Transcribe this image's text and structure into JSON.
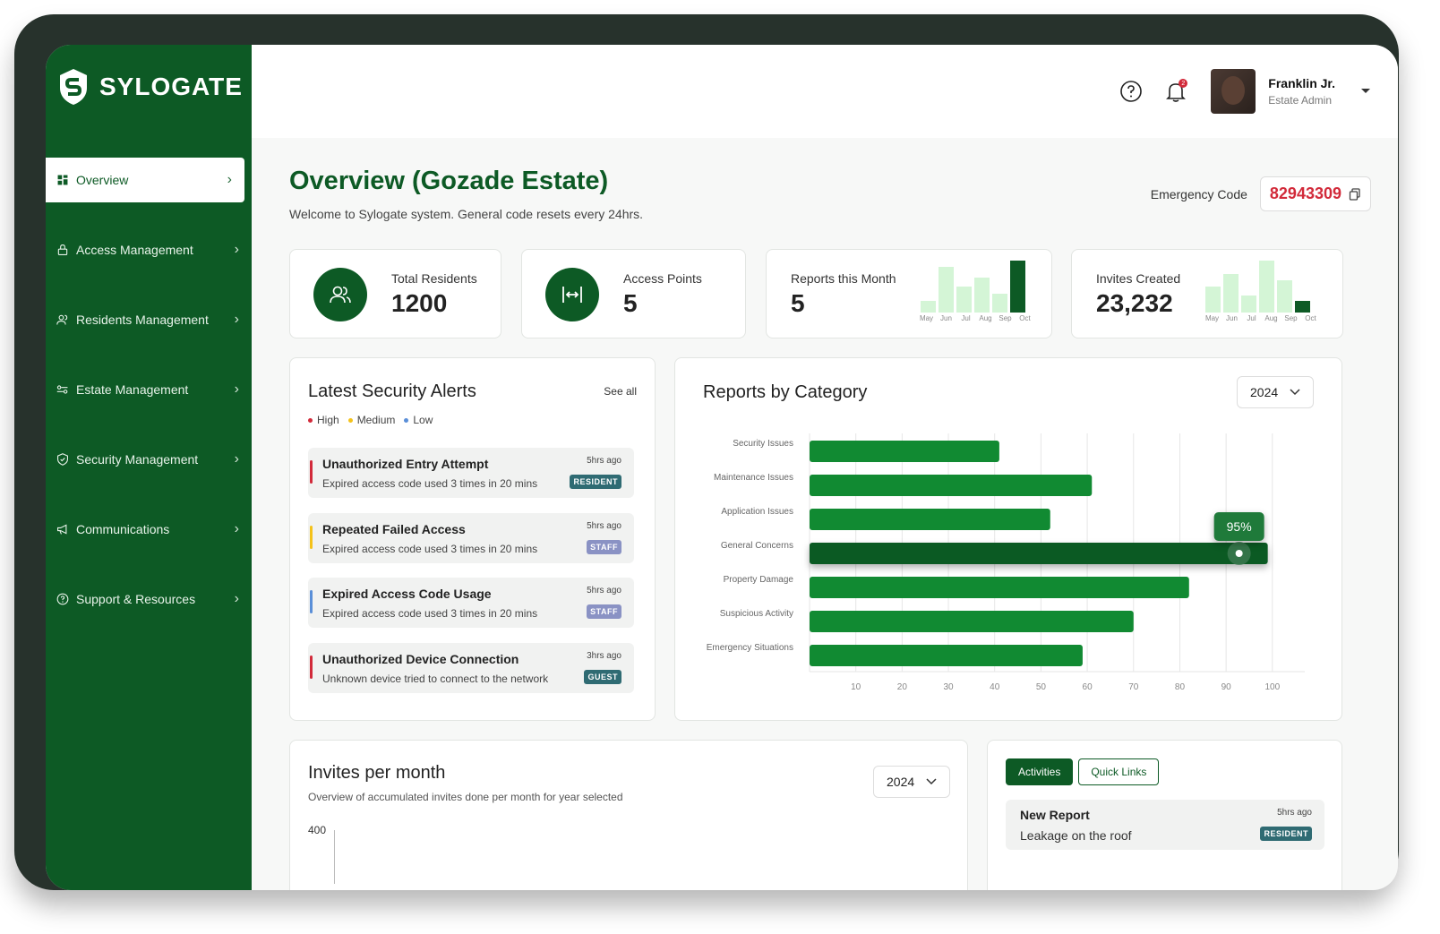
{
  "brand": {
    "name": "SYLOGATE"
  },
  "nav": [
    {
      "label": "Overview",
      "icon": "grid-icon",
      "active": true
    },
    {
      "label": "Access Management",
      "icon": "lock-icon"
    },
    {
      "label": "Residents Management",
      "icon": "users-icon"
    },
    {
      "label": "Estate Management",
      "icon": "estate-icon"
    },
    {
      "label": "Security Management",
      "icon": "shield-icon"
    },
    {
      "label": "Communications",
      "icon": "megaphone-icon"
    },
    {
      "label": "Support & Resources",
      "icon": "help-circle-icon"
    }
  ],
  "header": {
    "user_name": "Franklin Jr.",
    "user_role": "Estate Admin",
    "notification_count": "2"
  },
  "page": {
    "title": "Overview (Gozade Estate)",
    "subtitle": "Welcome to Sylogate system. General code resets every 24hrs.",
    "emergency_label": "Emergency Code",
    "emergency_code": "82943309"
  },
  "stats": {
    "residents": {
      "label": "Total Residents",
      "value": "1200"
    },
    "access": {
      "label": "Access Points",
      "value": "5"
    },
    "reports": {
      "label": "Reports this Month",
      "value": "5",
      "months": [
        "May",
        "Jun",
        "Jul",
        "Aug",
        "Sep",
        "Oct"
      ],
      "levels": [
        0.22,
        0.88,
        0.5,
        0.68,
        0.36,
        1.0
      ]
    },
    "invites": {
      "label": "Invites Created",
      "value": "23,232",
      "months": [
        "May",
        "Jun",
        "Jul",
        "Aug",
        "Sep",
        "Oct"
      ],
      "levels": [
        0.5,
        0.75,
        0.32,
        1.0,
        0.62,
        0.22
      ]
    }
  },
  "alerts": {
    "title": "Latest Security Alerts",
    "see_all": "See all",
    "legend": [
      {
        "label": "High",
        "color": "#d22a3a"
      },
      {
        "label": "Medium",
        "color": "#f4c21a"
      },
      {
        "label": "Low",
        "color": "#5a8fd8"
      }
    ],
    "items": [
      {
        "title": "Unauthorized Entry Attempt",
        "desc": "Expired access code used 3 times in 20 mins",
        "time": "5hrs ago",
        "badge": "RESIDENT",
        "badge_color": "#2f6b73",
        "severity_color": "#d22a3a"
      },
      {
        "title": "Repeated Failed Access",
        "desc": "Expired access code used 3 times in 20 mins",
        "time": "5hrs ago",
        "badge": "STAFF",
        "badge_color": "#8a92c4",
        "severity_color": "#f4c21a"
      },
      {
        "title": "Expired Access Code Usage",
        "desc": "Expired access code used 3 times in 20 mins",
        "time": "5hrs ago",
        "badge": "STAFF",
        "badge_color": "#8a92c4",
        "severity_color": "#5a8fd8"
      },
      {
        "title": "Unauthorized Device Connection",
        "desc": "Unknown device tried to connect to the network",
        "time": "3hrs ago",
        "badge": "GUEST",
        "badge_color": "#2f6b73",
        "severity_color": "#d22a3a"
      }
    ]
  },
  "reports_chart": {
    "title": "Reports by Category",
    "year": "2024",
    "tooltip": "95%"
  },
  "chart_data": {
    "type": "bar",
    "orientation": "horizontal",
    "categories": [
      "Security Issues",
      "Maintenance Issues",
      "Application Issues",
      "General Concerns",
      "Property Damage",
      "Suspicious Activity",
      "Emergency Situations"
    ],
    "values": [
      41,
      61,
      52,
      99,
      82,
      70,
      59
    ],
    "highlight_index": 3,
    "xlim": [
      0,
      107
    ],
    "xticks": [
      10,
      20,
      30,
      40,
      50,
      60,
      70,
      80,
      90,
      100
    ],
    "grid": true,
    "title": "Reports by Category",
    "xlabel": "",
    "ylabel": ""
  },
  "invites_chart": {
    "title": "Invites per month",
    "subtitle": "Overview of accumulated invites done per month for year selected",
    "year": "2024",
    "y_top_label": "400"
  },
  "activities": {
    "tabs": [
      "Activities",
      "Quick Links"
    ],
    "items": [
      {
        "title": "New Report",
        "desc": "Leakage on the roof",
        "time": "5hrs ago",
        "badge": "RESIDENT"
      }
    ]
  },
  "colors": {
    "brand": "#0d5a25",
    "bar": "#118a32",
    "bar_highlight": "#0b5a23",
    "mini_bar": "#d4f5d6",
    "danger": "#d22a3a"
  }
}
